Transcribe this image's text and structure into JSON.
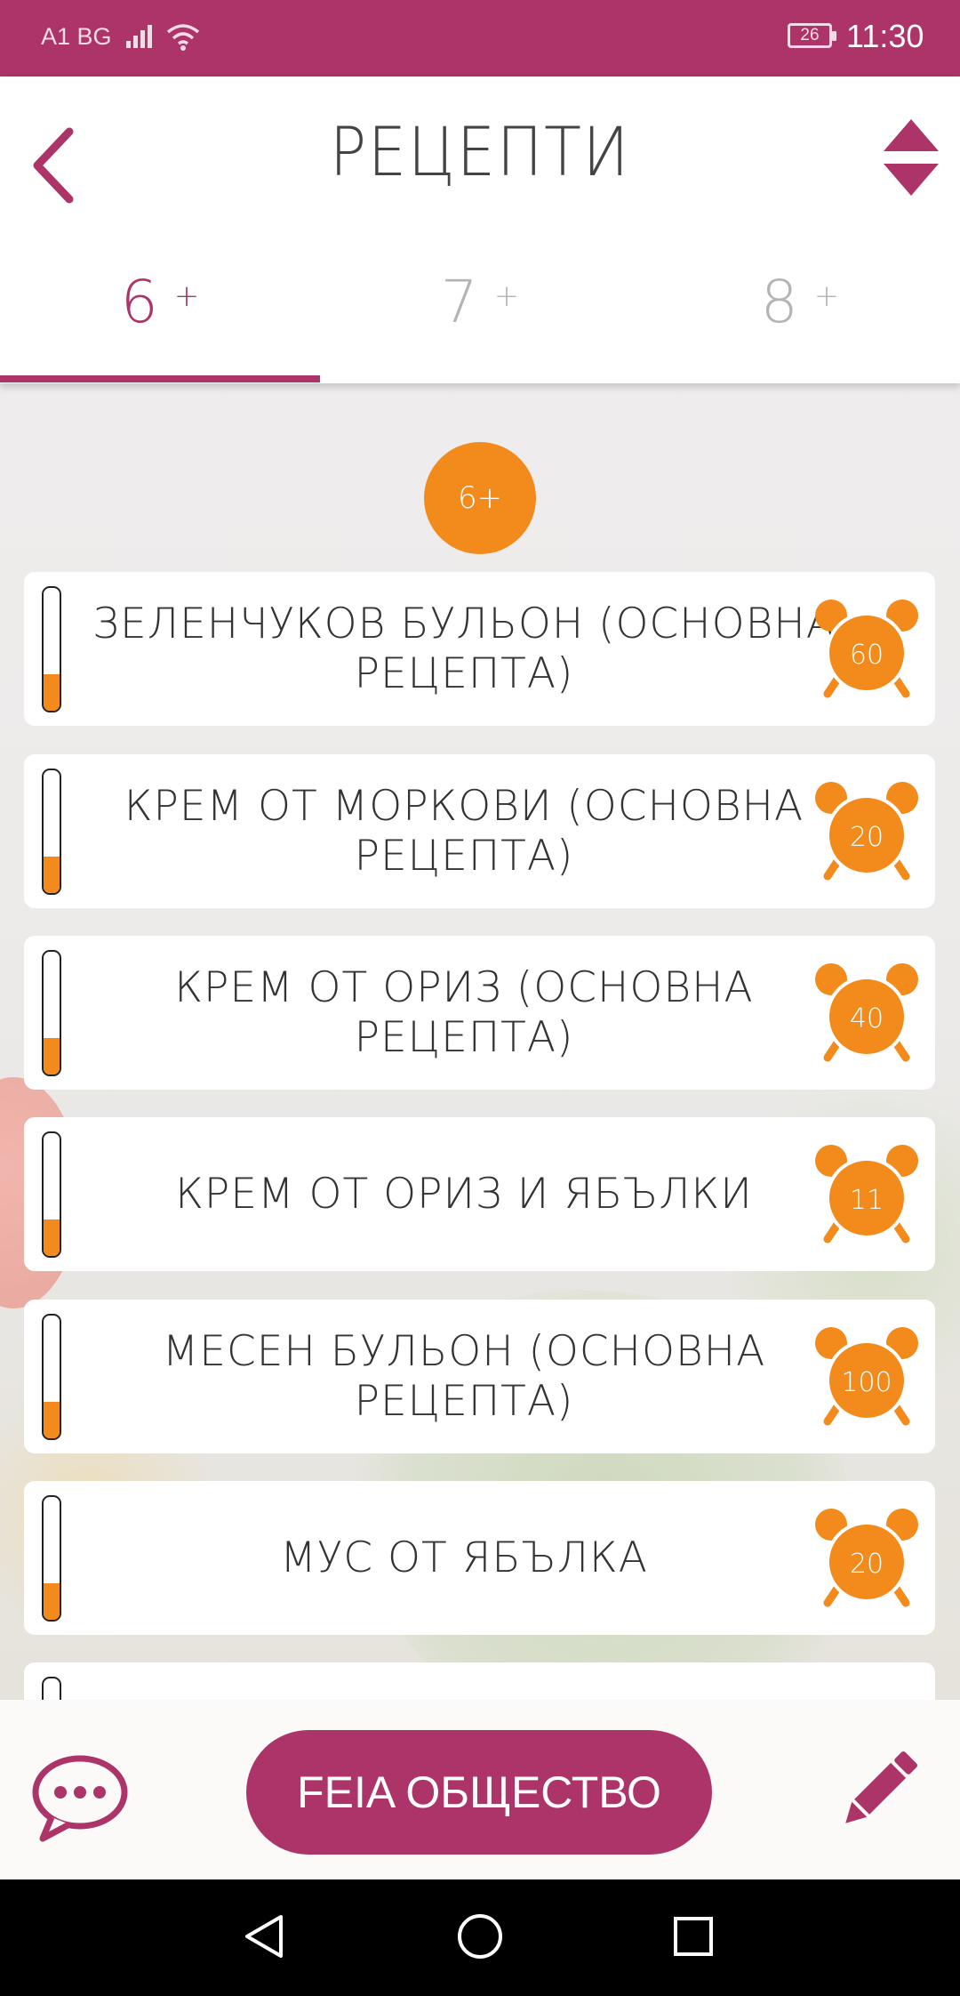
{
  "status_bar": {
    "carrier": "A1 BG",
    "battery": "26",
    "time": "11:30"
  },
  "header": {
    "title": "РЕЦЕПТИ",
    "tabs": [
      {
        "label": "6",
        "suffix": "+",
        "active": true
      },
      {
        "label": "7",
        "suffix": "+",
        "active": false
      },
      {
        "label": "8",
        "suffix": "+",
        "active": false
      }
    ]
  },
  "age_badge": "6+",
  "recipes": [
    {
      "title": "ЗЕЛЕНЧУКОВ БУЛЬОН (ОСНОВНА РЕЦЕПТА)",
      "time": "60",
      "level": 0.3
    },
    {
      "title": "КРЕМ ОТ МОРКОВИ (ОСНОВНА РЕЦЕПТА)",
      "time": "20",
      "level": 0.3
    },
    {
      "title": "КРЕМ ОТ ОРИЗ (ОСНОВНА РЕЦЕПТА)",
      "time": "40",
      "level": 0.3
    },
    {
      "title": "КРЕМ ОТ ОРИЗ И ЯБЪЛКИ",
      "time": "11",
      "level": 0.3
    },
    {
      "title": "МЕСЕН БУЛЬОН (ОСНОВНА РЕЦЕПТА)",
      "time": "100",
      "level": 0.3
    },
    {
      "title": "МУС ОТ ЯБЪЛКА",
      "time": "20",
      "level": 0.3
    }
  ],
  "bottom_bar": {
    "community_button": "FEIA ОБЩЕСТВО"
  },
  "colors": {
    "brand": "#ac3468",
    "accent": "#f28a1c"
  },
  "icons": {
    "back": "chevron-left-icon",
    "sort": "sort-icon",
    "timer": "alarm-clock-icon",
    "chat": "chat-bubble-icon",
    "edit": "pencil-icon"
  }
}
